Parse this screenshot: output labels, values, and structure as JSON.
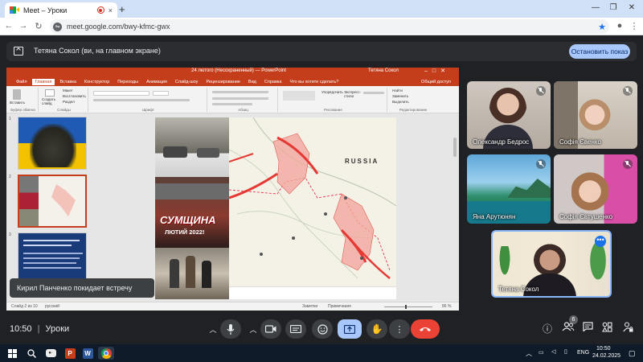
{
  "browser": {
    "tab_title": "Meet – Уроки",
    "tab_close": "×",
    "new_tab": "+",
    "url": "meet.google.com/bwy-kfmc-gwx"
  },
  "banner": {
    "text": "Тетяна Сокол (ви, на главном экране)",
    "stop_label": "Остановить показ"
  },
  "powerpoint": {
    "window_title": "24 лютого (Несохраненный) — PowerPoint",
    "user": "Тетяна Сокол",
    "tabs": [
      "Файл",
      "Главная",
      "Вставка",
      "Конструктор",
      "Переходы",
      "Анимация",
      "Слайд-шоу",
      "Рецензирование",
      "Вид",
      "Справка",
      "Что вы хотите сделать?"
    ],
    "active_tab": "Главная",
    "share_label": "Общий доступ",
    "ribbon_groups": [
      "Буфер обмена",
      "Слайды",
      "Шрифт",
      "Абзац",
      "Рисование",
      "Редактирование"
    ],
    "ribbon_buttons": [
      "Вставить",
      "Создать слайд",
      "Макет",
      "Восстановить",
      "Раздел",
      "Упорядочить",
      "Экспресс-стили",
      "Найти",
      "Заменить",
      "Выделить"
    ],
    "status": {
      "slide": "Слайд 2 из 10",
      "language": "русский",
      "notes": "Заметки",
      "comments": "Примечания",
      "zoom": "86 %"
    },
    "slide": {
      "map_label": "RUSSIA",
      "poster_title": "СУМЩИНА",
      "poster_subtitle": "ЛЮТИЙ 2022!"
    }
  },
  "participants": [
    {
      "name": "Олександр Бедрос",
      "muted": true
    },
    {
      "name": "Софія Євенко",
      "muted": true
    },
    {
      "name": "Яна Арутюнян",
      "muted": true
    },
    {
      "name": "Софія Євтушенко",
      "muted": true
    },
    {
      "name": "Тетяна Сокол",
      "muted": false
    }
  ],
  "toast": "Кирил Панченко покидает встречу",
  "meeting": {
    "time": "10:50",
    "separator": "|",
    "name": "Уроки",
    "people_count": "6"
  },
  "taskbar": {
    "time": "10:50",
    "date": "24.02.2025",
    "lang": "ENG"
  },
  "colors": {
    "ppt_accent": "#c43e1c",
    "meet_bg": "#202124",
    "stop_button": "#a8c7fa",
    "present_button": "#a8c7fa",
    "end_call": "#ea4335"
  }
}
